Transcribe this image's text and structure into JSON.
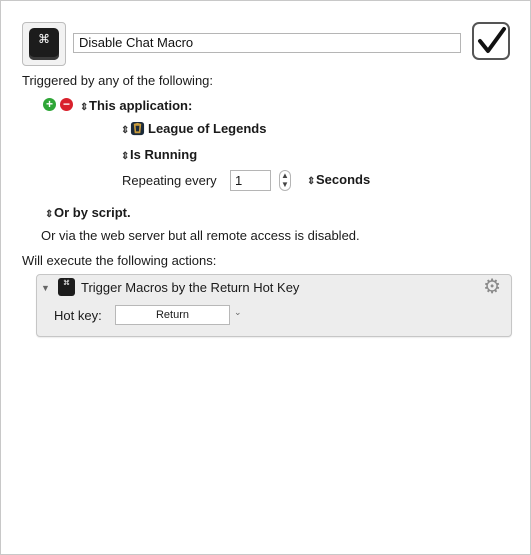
{
  "macro": {
    "name": "Disable Chat Macro",
    "icon": "command-key-icon",
    "icon_glyph": "⌘",
    "enabled": true
  },
  "triggers": {
    "header": "Triggered by any of the following:",
    "application_trigger_label": "This application:",
    "application_name": "League of Legends",
    "condition": "Is Running",
    "repeating_label": "Repeating every",
    "repeating_value": "1",
    "unit": "Seconds",
    "script_label": "Or by script.",
    "web_server_text": "Or via the web server but all remote access is disabled."
  },
  "actions": {
    "header": "Will execute the following actions:",
    "items": [
      {
        "title": "Trigger Macros by the Return Hot Key",
        "hotkey_label": "Hot key:",
        "hotkey_value": "Return"
      }
    ]
  },
  "colors": {
    "add": "#2ea637",
    "remove": "#d9212c",
    "action_bg": "#ededed"
  }
}
